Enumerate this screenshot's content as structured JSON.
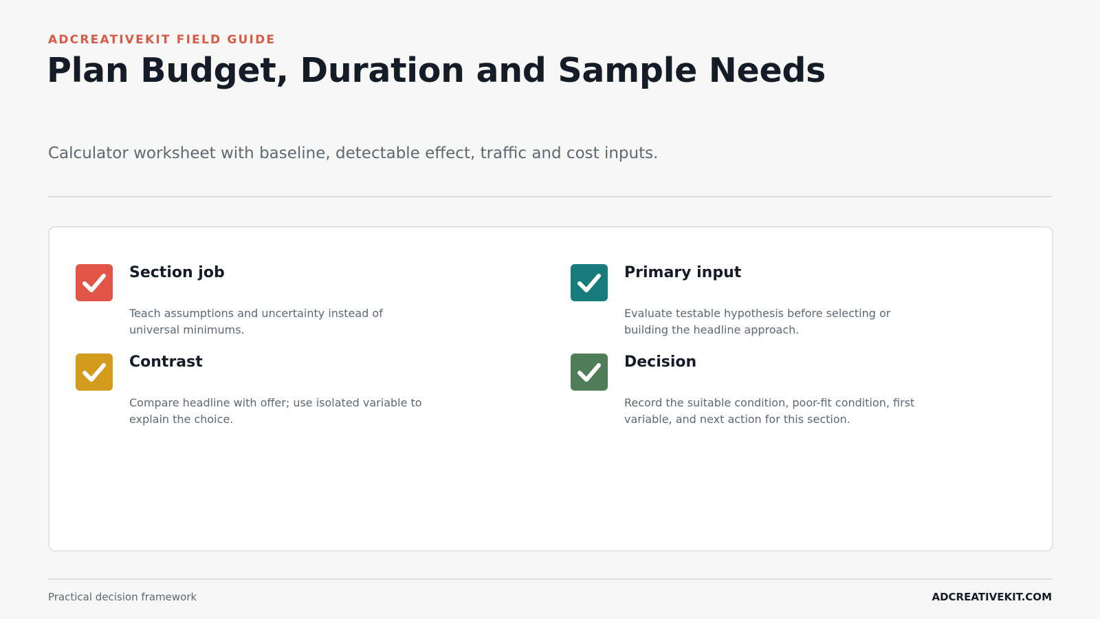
{
  "header": {
    "eyebrow": "ADCREATIVEKIT FIELD GUIDE",
    "title": "Plan Budget, Duration and Sample Needs",
    "subtitle": "Calculator worksheet with baseline, detectable effect, traffic and cost inputs."
  },
  "items": [
    {
      "title": "Section job",
      "text": "Teach assumptions and uncertainty instead of universal minimums.",
      "icon": "checkbox-checked-icon",
      "color": "#e05545"
    },
    {
      "title": "Primary input",
      "text": "Evaluate testable hypothesis before selecting or building the headline approach.",
      "icon": "checkbox-checked-icon",
      "color": "#177b7c"
    },
    {
      "title": "Contrast",
      "text": "Compare headline with offer; use isolated variable to explain the choice.",
      "icon": "checkbox-checked-icon",
      "color": "#d29b1e"
    },
    {
      "title": "Decision",
      "text": "Record the suitable condition, poor-fit condition, first variable, and next action for this section.",
      "icon": "checkbox-checked-icon",
      "color": "#4f7d57"
    }
  ],
  "footer": {
    "left": "Practical decision framework",
    "right": "ADCREATIVEKIT.COM"
  }
}
